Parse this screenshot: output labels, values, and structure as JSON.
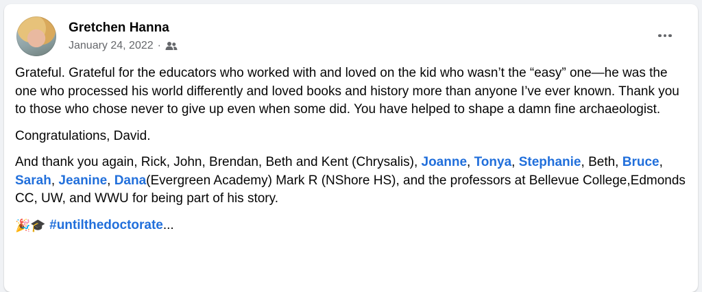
{
  "post": {
    "author": "Gretchen Hanna",
    "date": "January 24, 2022",
    "separator": "·",
    "audience_icon": "friends-icon",
    "more_icon": "more-options-icon",
    "paragraphs": {
      "p1": "Grateful. Grateful for the educators who worked with and loved on the kid who wasn’t the “easy” one—he was the one who processed his world differently and loved books and history more than anyone I’ve ever known. Thank you to those who chose never to give up even when some did. You have helped to shape a damn fine archaeologist.",
      "p2": "Congratulations, David.",
      "p3": {
        "t1": "And thank you again, Rick, John, Brendan, Beth and Kent (Chrysalis), ",
        "m1": "Joanne",
        "s1": ", ",
        "m2": "Tonya",
        "s2": ", ",
        "m3": "Stephanie",
        "t2": ", Beth, ",
        "m4": "Bruce",
        "s3": ", ",
        "m5": "Sarah",
        "s4": ", ",
        "m6": "Jeanine",
        "s5": ", ",
        "m7": "Dana",
        "t3": "(Evergreen Academy) Mark R (NShore HS), and the professors at Bellevue College,Edmonds CC, UW, and WWU for being part of his story."
      },
      "p4": {
        "emoji1": "🎉",
        "emoji2": "🎓",
        "hashtag": "#untilthedoctorate",
        "ellipsis": "..."
      }
    },
    "colors": {
      "link": "#216fdb",
      "meta": "#65676b",
      "text": "#050505"
    }
  }
}
